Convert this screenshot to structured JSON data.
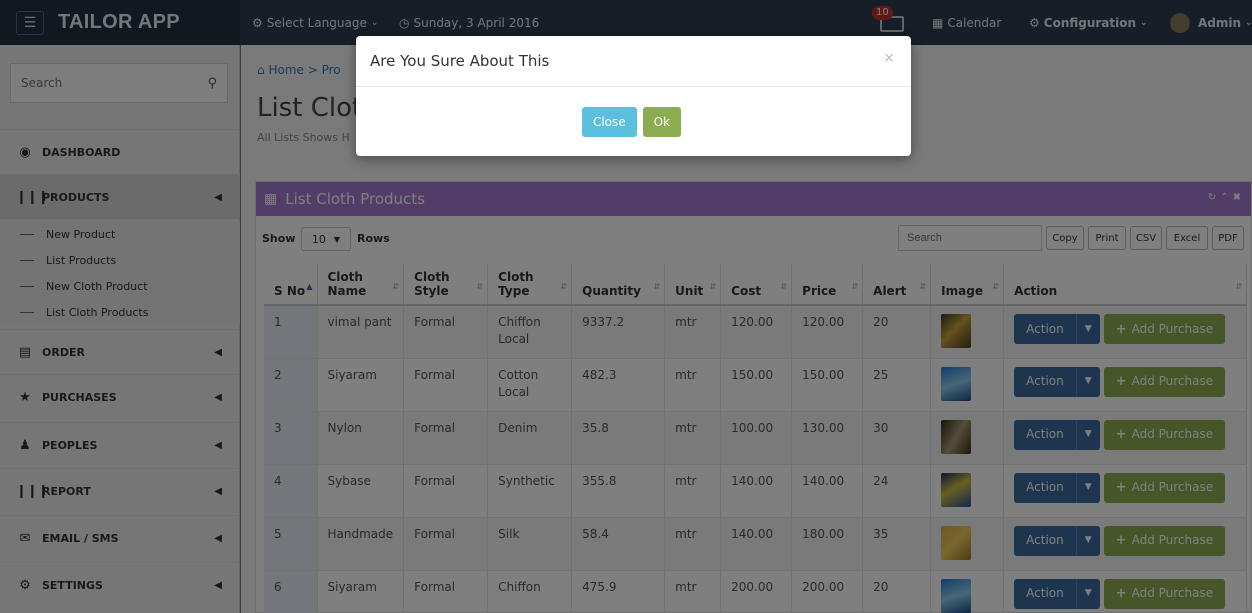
{
  "app": {
    "title": "TAILOR APP"
  },
  "topbar": {
    "language": "Select Language",
    "date": "Sunday, 3 April 2016",
    "notification_count": "10",
    "calendar": "Calendar",
    "configuration": "Configuration",
    "user": "Admin"
  },
  "sidebar": {
    "search_placeholder": "Search",
    "items": [
      {
        "label": "DASHBOARD",
        "icon": "dashboard-icon"
      },
      {
        "label": "PRODUCTS",
        "icon": "barcode-icon"
      },
      {
        "label": "ORDER",
        "icon": "order-icon"
      },
      {
        "label": "PURCHASES",
        "icon": "star-icon"
      },
      {
        "label": "PEOPLES",
        "icon": "users-icon"
      },
      {
        "label": "REPORT",
        "icon": "barcode-icon"
      },
      {
        "label": "EMAIL / SMS",
        "icon": "envelope-icon"
      },
      {
        "label": "SETTINGS",
        "icon": "cogs-icon"
      }
    ],
    "sub_items": [
      "New Product",
      "List Products",
      "New Cloth Product",
      "List Cloth Products"
    ]
  },
  "page": {
    "breadcrumb": "Home > Pro",
    "title": "List Clot",
    "subtitle": "All Lists Shows H"
  },
  "panel": {
    "title": "List Cloth Products",
    "show_label": "Show",
    "rows_value": "10",
    "rows_label": "Rows",
    "search_placeholder": "Search",
    "exports": [
      "Copy",
      "Print",
      "CSV",
      "Excel",
      "PDF"
    ]
  },
  "table": {
    "headers": [
      "S No",
      "Cloth Name",
      "Cloth Style",
      "Cloth Type",
      "Quantity",
      "Unit",
      "Cost",
      "Price",
      "Alert",
      "Image",
      "Action"
    ],
    "action_label": "Action",
    "add_label": "Add Purchase",
    "rows": [
      [
        "1",
        "vimal pant",
        "Formal",
        "Chiffon Local",
        "9337.2",
        "mtr",
        "120.00",
        "120.00",
        "20"
      ],
      [
        "2",
        "Siyaram",
        "Formal",
        "Cotton Local",
        "482.3",
        "mtr",
        "150.00",
        "150.00",
        "25"
      ],
      [
        "3",
        "Nylon",
        "Formal",
        "Denim",
        "35.8",
        "mtr",
        "100.00",
        "130.00",
        "30"
      ],
      [
        "4",
        "Sybase",
        "Formal",
        "Synthetic",
        "355.8",
        "mtr",
        "140.00",
        "140.00",
        "24"
      ],
      [
        "5",
        "Handmade",
        "Formal",
        "Silk",
        "58.4",
        "mtr",
        "140.00",
        "180.00",
        "35"
      ],
      [
        "6",
        "Siyaram",
        "Formal",
        "Chiffon",
        "475.9",
        "mtr",
        "200.00",
        "200.00",
        "20"
      ]
    ]
  },
  "modal": {
    "title": "Are You Sure About This",
    "close_label": "Close",
    "ok_label": "Ok"
  },
  "colors": {
    "topbar": "#2c3e50",
    "panel_header": "#a57bd2",
    "action_button": "#3a6a9e",
    "add_button": "#8cac52",
    "modal_close": "#5bc0de"
  }
}
